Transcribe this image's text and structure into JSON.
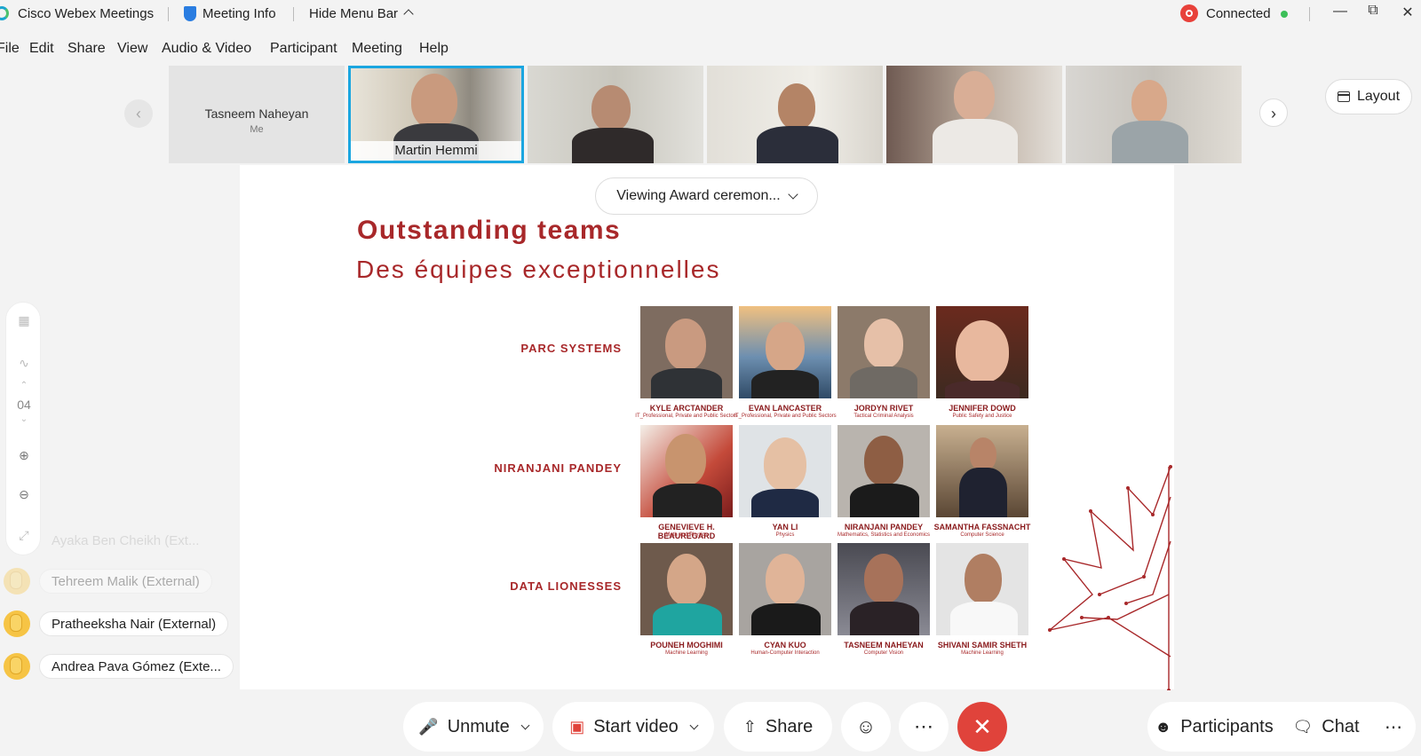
{
  "titlebar": {
    "app_name": "Cisco Webex Meetings",
    "meeting_info": "Meeting Info",
    "hide_menu": "Hide Menu Bar",
    "status": "Connected"
  },
  "menubar": [
    "File",
    "Edit",
    "Share",
    "View",
    "Audio & Video",
    "Participant",
    "Meeting",
    "Help"
  ],
  "strip": {
    "me_name": "Tasneem Naheyan",
    "me_label": "Me",
    "active_speaker": "Martin Hemmi",
    "layout_label": "Layout"
  },
  "share": {
    "viewing": "Viewing Award ceremon..."
  },
  "slide": {
    "title": "Outstanding teams",
    "subtitle": "Des équipes exceptionnelles",
    "teams": [
      {
        "name": "PARC SYSTEMS",
        "members": [
          {
            "name": "KYLE ARCTANDER",
            "field": "IT_Professional, Private and Public Sectors"
          },
          {
            "name": "EVAN LANCASTER",
            "field": "IT_Professional, Private and Public Sectors"
          },
          {
            "name": "JORDYN RIVET",
            "field": "Tactical Criminal Analysis"
          },
          {
            "name": "JENNIFER DOWD",
            "field": "Public Safety and Justice"
          }
        ]
      },
      {
        "name": "NIRANJANI PANDEY",
        "members": [
          {
            "name": "GENEVIEVE H. BEAUREGARD",
            "field": "Math and Physics"
          },
          {
            "name": "YAN LI",
            "field": "Physics"
          },
          {
            "name": "NIRANJANI PANDEY",
            "field": "Mathematics, Statistics and Economics"
          },
          {
            "name": "SAMANTHA FASSNACHT",
            "field": "Computer Science"
          }
        ]
      },
      {
        "name": "DATA LIONESSES",
        "members": [
          {
            "name": "POUNEH MOGHIMI",
            "field": "Machine Learning"
          },
          {
            "name": "CYAN KUO",
            "field": "Human-Computer Interaction"
          },
          {
            "name": "TASNEEM NAHEYAN",
            "field": "Computer Vision"
          },
          {
            "name": "SHIVANI SAMIR SHETH",
            "field": "Machine Learning"
          }
        ]
      }
    ]
  },
  "tools": {
    "page_number": "04"
  },
  "reactions": [
    {
      "name": "Ayaka Ben Cheikh (Ext...",
      "state": "fading"
    },
    {
      "name": "Tehreem Malik (External)",
      "state": "faded"
    },
    {
      "name": "Pratheeksha Nair (External)",
      "state": "active"
    },
    {
      "name": "Andrea Pava Gómez (Exte...",
      "state": "active"
    }
  ],
  "controls": {
    "unmute": "Unmute",
    "start_video": "Start video",
    "share": "Share",
    "participants": "Participants",
    "chat": "Chat"
  },
  "colors": {
    "accent_red": "#e0433b",
    "slide_red": "#a8282a",
    "active_border": "#1ba6e0"
  }
}
